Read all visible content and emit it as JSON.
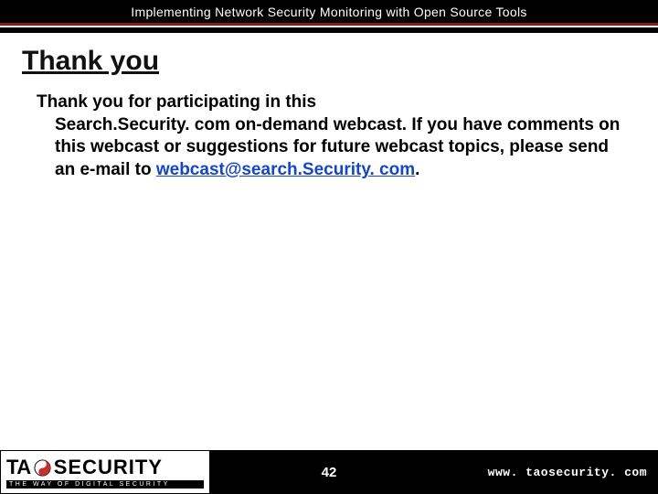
{
  "header": {
    "title": "Implementing Network Security Monitoring with Open Source Tools"
  },
  "slide": {
    "title": "Thank you",
    "body_lead": "Thank you for participating in this",
    "body_rest_before_link": "Search.Security. com on-demand webcast. If you have comments on this webcast or suggestions for future webcast topics, please send an e-mail to ",
    "email": "webcast@search.Security. com",
    "body_after_link": "."
  },
  "footer": {
    "logo": {
      "ta": "TA",
      "security": "SECURITY",
      "tagline": "THE WAY OF DIGITAL SECURITY"
    },
    "page_number": "42",
    "url": "www. taosecurity. com"
  }
}
